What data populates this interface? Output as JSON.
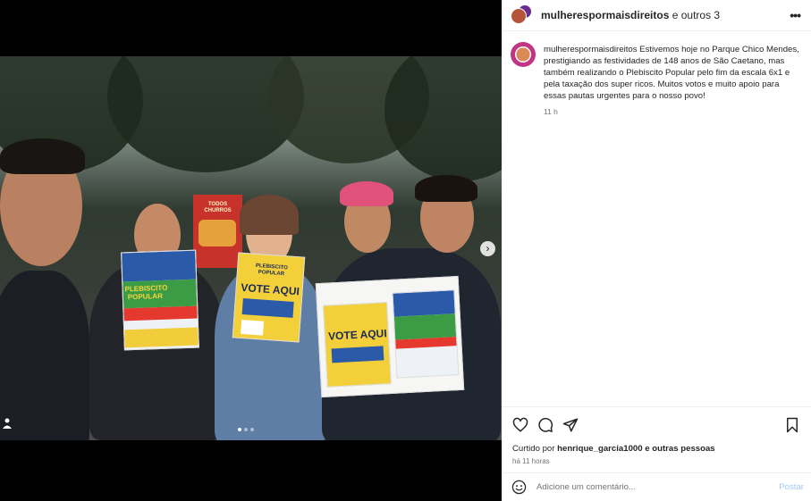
{
  "header": {
    "account": "mulherespormaisdireitos",
    "others": " e outros 3"
  },
  "caption": {
    "username": "mulherespormaisdireitos",
    "text": " Estivemos hoje no Parque Chico Mendes, prestigiando as festividades de 148 anos de São Caetano, mas também realizando o Plebiscito Popular pelo fim da escala 6x1 e pela taxação dos super ricos. Muitos votos e muito apoio para essas pautas urgentes para o nosso povo!",
    "time": "11 h"
  },
  "likes": {
    "prefix": "Curtido por ",
    "user": "henrique_garcia1000",
    "suffix": " e outras pessoas"
  },
  "timestamp": "há 11 horas",
  "comment": {
    "placeholder": "Adicione um comentário...",
    "post_label": "Postar"
  },
  "photo": {
    "flyer_left_title": "PLEBISCITO POPULAR",
    "flyer_center_title": "VOTE AQUI",
    "flyer_center_logo": "PLEBISCITO POPULAR",
    "flyer_box_title": "VOTE AQUI",
    "banner_text": "TODOS CHURROS",
    "carousel_count": 3,
    "carousel_active": 1
  },
  "colors": {
    "post_button": "#9fc9f5",
    "text": "#262626",
    "muted": "#737373"
  }
}
